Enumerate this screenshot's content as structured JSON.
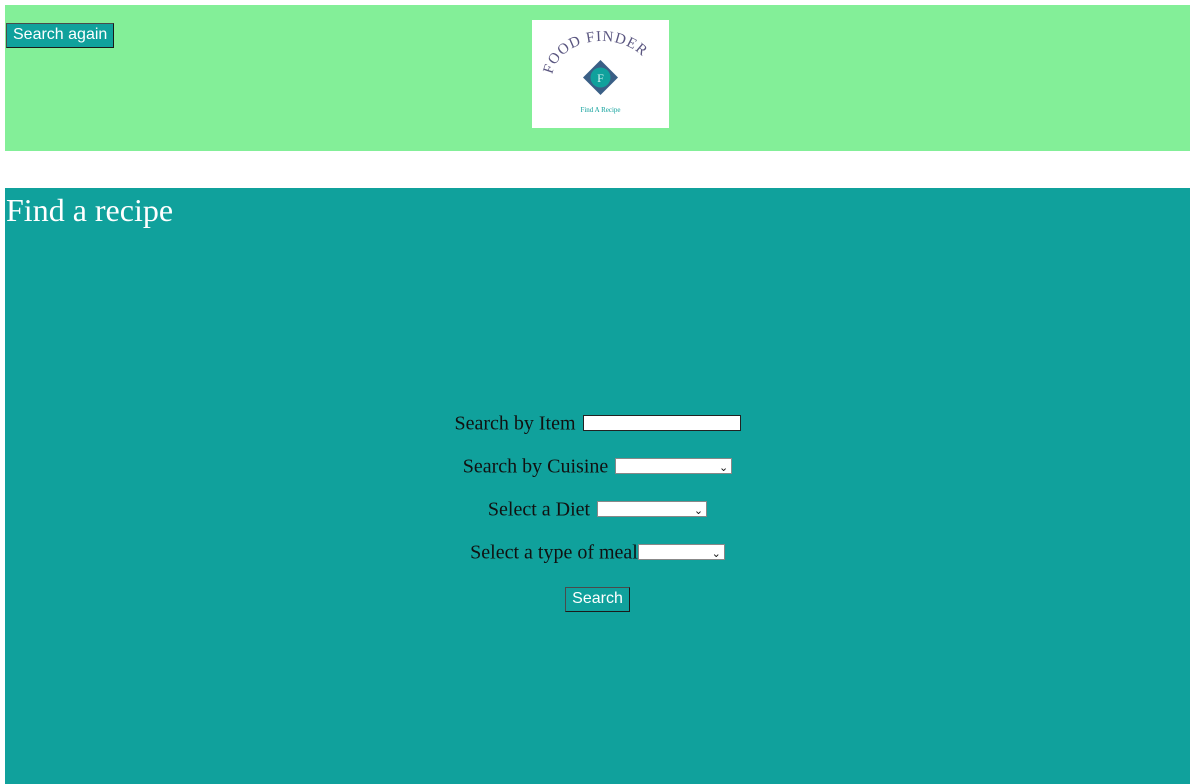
{
  "header": {
    "search_again_label": "Search again",
    "logo": {
      "brand_text": "FOOD FINDER",
      "initial": "F",
      "tagline": "Find A Recipe"
    }
  },
  "main": {
    "title": "Find a recipe",
    "form": {
      "item_label": "Search by Item",
      "item_value": "",
      "cuisine_label": "Search by Cuisine",
      "cuisine_selected": "",
      "diet_label": "Select a Diet",
      "diet_selected": "",
      "meal_label": "Select a type of meal",
      "meal_selected": "",
      "search_label": "Search"
    }
  },
  "colors": {
    "header_bg": "#83ef98",
    "main_bg": "#10a19c",
    "button_bg": "#10a19c"
  }
}
